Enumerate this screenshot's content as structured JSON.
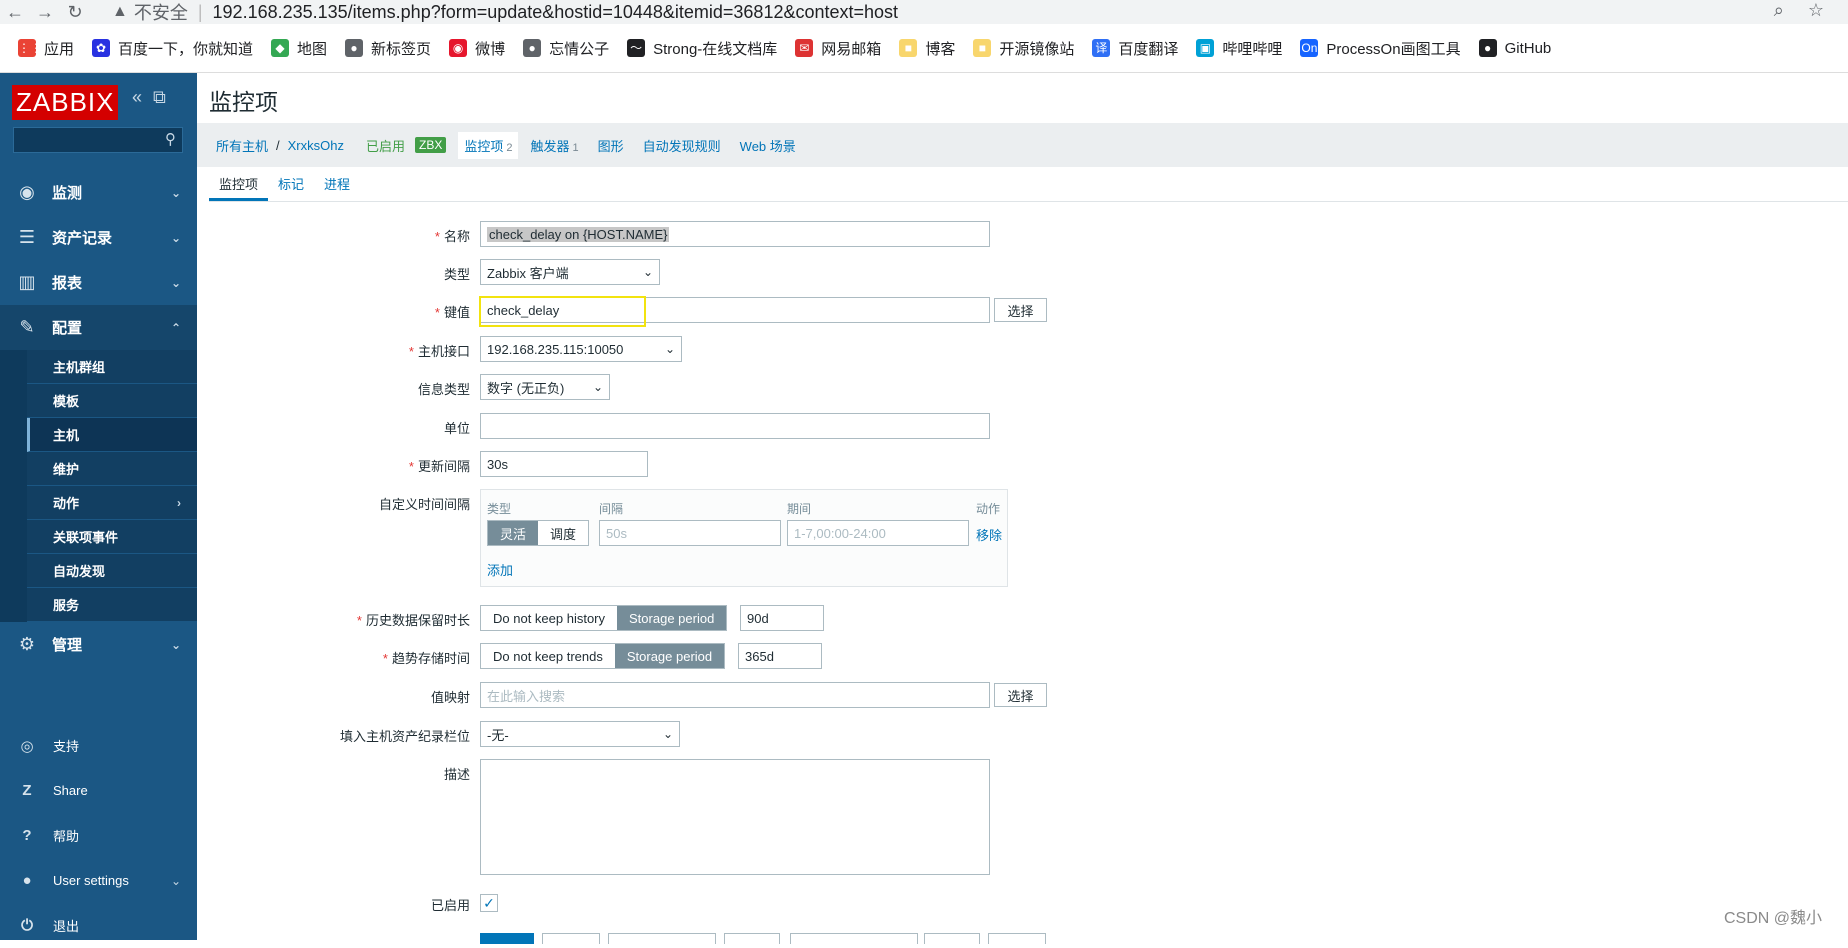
{
  "browser": {
    "back_icon": "←",
    "forward_icon": "→",
    "reload_icon": "↻",
    "security_icon": "▲",
    "insecure_label": "不安全",
    "url": "192.168.235.135/items.php?form=update&hostid=10448&itemid=36812&context=host",
    "bookmarks": [
      {
        "label": "应用",
        "icon_color": "#ea4335"
      },
      {
        "label": "百度一下，你就知道",
        "icon_color": "#2932e1"
      },
      {
        "label": "地图",
        "icon_color": "#34a853"
      },
      {
        "label": "新标签页",
        "icon_color": "#5f6368"
      },
      {
        "label": "微博",
        "icon_color": "#e6162d"
      },
      {
        "label": "忘情公子",
        "icon_color": "#5f6368"
      },
      {
        "label": "Strong-在线文档库",
        "icon_color": "#202124"
      },
      {
        "label": "网易邮箱",
        "icon_color": "#d33"
      },
      {
        "label": "博客",
        "icon_color": "#f8d66d"
      },
      {
        "label": "开源镜像站",
        "icon_color": "#f8d66d"
      },
      {
        "label": "百度翻译",
        "icon_color": "#2f6ff5"
      },
      {
        "label": "哔哩哔哩",
        "icon_color": "#00a1d6"
      },
      {
        "label": "ProcessOn画图工具",
        "icon_color": "#1664ff"
      },
      {
        "label": "GitHub",
        "icon_color": "#202124"
      }
    ],
    "bm_icons": [
      "⋮⋮",
      "✿",
      "◆",
      "●",
      "◉",
      "●",
      "〜",
      "✉",
      "■",
      "■",
      "译",
      "▣",
      "On",
      "●"
    ]
  },
  "sidebar": {
    "logo": "ZABBIX",
    "menu": [
      {
        "label": "监测",
        "icon": "◉"
      },
      {
        "label": "资产记录",
        "icon": "☰"
      },
      {
        "label": "报表",
        "icon": "▥"
      },
      {
        "label": "配置",
        "icon": "✎"
      }
    ],
    "submenu": [
      "主机群组",
      "模板",
      "主机",
      "维护",
      "动作",
      "关联项事件",
      "自动发现",
      "服务"
    ],
    "admin": {
      "label": "管理",
      "icon": "⚙"
    },
    "bottom": [
      {
        "label": "支持",
        "icon": "◎"
      },
      {
        "label": "Share",
        "icon": "Z"
      },
      {
        "label": "帮助",
        "icon": "?"
      },
      {
        "label": "User settings",
        "icon": "●"
      },
      {
        "label": "退出",
        "icon": "⏻"
      }
    ]
  },
  "header": {
    "title": "监控项",
    "breadcrumbs": {
      "all_hosts": "所有主机",
      "sep": "/",
      "host": "XrxksOhz",
      "enabled": "已启用",
      "zbx": "ZBX",
      "items": "监控项",
      "items_count": "2",
      "triggers": "触发器",
      "triggers_count": "1",
      "graphs": "图形",
      "discovery": "自动发现规则",
      "web": "Web 场景"
    },
    "tabs": [
      "监控项",
      "标记",
      "进程"
    ]
  },
  "form": {
    "name_label": "名称",
    "name_value": "check_delay on {HOST.NAME}",
    "type_label": "类型",
    "type_value": "Zabbix 客户端",
    "key_label": "键值",
    "key_value": "check_delay",
    "select_label": "选择",
    "interface_label": "主机接口",
    "interface_value": "192.168.235.115:10050",
    "info_type_label": "信息类型",
    "info_type_value": "数字 (无正负)",
    "units_label": "单位",
    "units_value": "",
    "interval_label": "更新间隔",
    "interval_value": "30s",
    "custom_label": "自定义时间间隔",
    "custom": {
      "col_type": "类型",
      "col_interval": "间隔",
      "col_period": "期间",
      "col_action": "动作",
      "flexible": "灵活",
      "scheduling": "调度",
      "interval_placeholder": "50s",
      "period_placeholder": "1-7,00:00-24:00",
      "remove": "移除",
      "add": "添加"
    },
    "history_label": "历史数据保留时长",
    "history_off": "Do not keep history",
    "history_on": "Storage period",
    "history_value": "90d",
    "trends_label": "趋势存储时间",
    "trends_off": "Do not keep trends",
    "trends_on": "Storage period",
    "trends_value": "365d",
    "valuemap_label": "值映射",
    "valuemap_placeholder": "在此输入搜索",
    "inventory_label": "填入主机资产纪录栏位",
    "inventory_value": "-无-",
    "description_label": "描述",
    "enabled_label": "已启用",
    "check_mark": "✓"
  },
  "watermark": "CSDN @魏小"
}
